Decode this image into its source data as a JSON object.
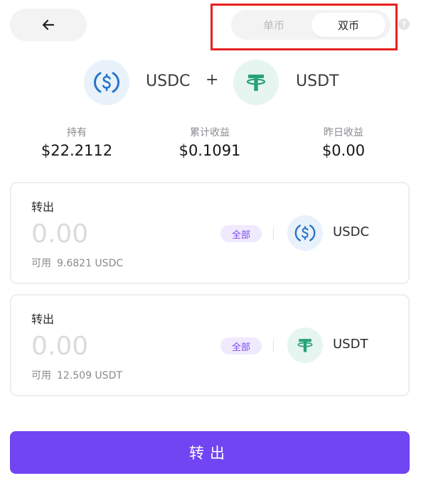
{
  "header": {
    "back_icon": "arrow-left-icon",
    "toggle": {
      "options": [
        "单币",
        "双币"
      ],
      "selected": "双币"
    },
    "help_icon": "question-circle-icon",
    "help_glyph": "?"
  },
  "pair": {
    "coin_a": {
      "symbol": "USDC",
      "icon": "usdc-icon",
      "color": "#2775ca"
    },
    "separator": "+",
    "coin_b": {
      "symbol": "USDT",
      "icon": "usdt-icon",
      "color": "#26a17b"
    }
  },
  "stats": [
    {
      "label": "持有",
      "value": "$22.2112"
    },
    {
      "label": "累计收益",
      "value": "$0.1091"
    },
    {
      "label": "昨日收益",
      "value": "$0.00"
    }
  ],
  "cards": [
    {
      "title": "转出",
      "amount_placeholder": "0.00",
      "all_label": "全部",
      "coin": "USDC",
      "available_label": "可用",
      "available_value": "9.6821 USDC"
    },
    {
      "title": "转出",
      "amount_placeholder": "0.00",
      "all_label": "全部",
      "coin": "USDT",
      "available_label": "可用",
      "available_value": "12.509 USDT"
    }
  ],
  "submit_label": "转出",
  "colors": {
    "accent": "#7145f2",
    "highlight_border": "#e8221f"
  }
}
